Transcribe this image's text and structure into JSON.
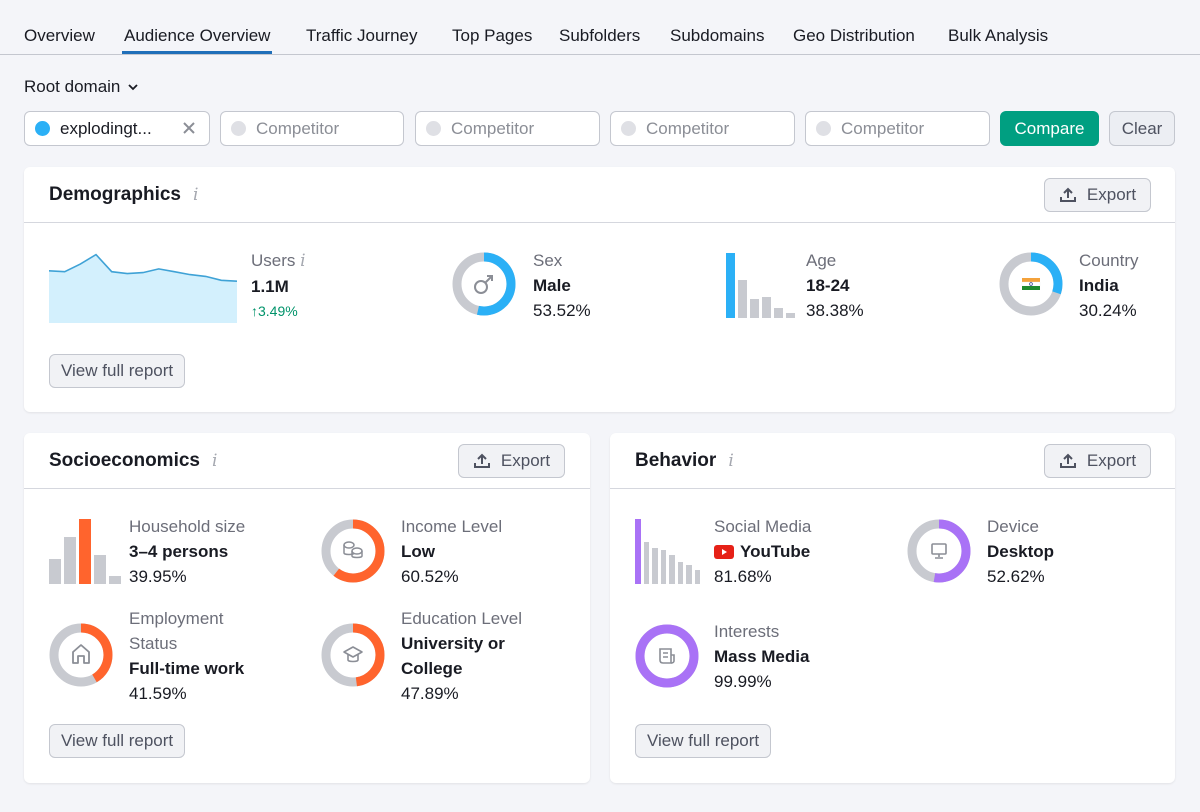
{
  "tabs": [
    {
      "label": "Overview",
      "active": false
    },
    {
      "label": "Audience Overview",
      "active": true
    },
    {
      "label": "Traffic Journey",
      "active": false
    },
    {
      "label": "Top Pages",
      "active": false
    },
    {
      "label": "Subfolders",
      "active": false
    },
    {
      "label": "Subdomains",
      "active": false
    },
    {
      "label": "Geo Distribution",
      "active": false
    },
    {
      "label": "Bulk Analysis",
      "active": false
    }
  ],
  "filters": {
    "scope_label": "Root domain",
    "domain_value": "explodingt...",
    "competitor_placeholder": "Competitor",
    "compare_label": "Compare",
    "clear_label": "Clear"
  },
  "colors": {
    "accent_blue": "#2bb0f6",
    "accent_orange": "#ff642d",
    "accent_purple": "#a972f6",
    "compare_green": "#009f81",
    "growth_green": "#00936a",
    "inactive_gray": "#c8cad0"
  },
  "common": {
    "export_label": "Export",
    "view_report_label": "View full report"
  },
  "demographics": {
    "title": "Demographics",
    "users": {
      "label": "Users",
      "value": "1.1M",
      "growth": "↑3.49%",
      "trend": [
        55,
        54,
        62,
        72,
        54,
        52,
        53,
        57,
        54,
        51,
        49,
        45,
        44
      ]
    },
    "sex": {
      "label": "Sex",
      "value": "Male",
      "pct": "53.52%",
      "share": 53.52
    },
    "age": {
      "label": "Age",
      "value": "18-24",
      "pct": "38.38%",
      "bars": [
        100,
        59,
        30,
        33,
        15,
        8
      ]
    },
    "country": {
      "label": "Country",
      "value": "India",
      "pct": "30.24%",
      "share": 30.24
    }
  },
  "socioeconomics": {
    "title": "Socioeconomics",
    "household": {
      "label": "Household size",
      "value": "3–4 persons",
      "pct": "39.95%",
      "bars": [
        39,
        72,
        100,
        44,
        12
      ],
      "highlight": 2
    },
    "income": {
      "label": "Income Level",
      "value": "Low",
      "pct": "60.52%",
      "share": 60.52
    },
    "employment": {
      "label_line1": "Employment",
      "label_line2": "Status",
      "value": "Full-time work",
      "pct": "41.59%",
      "share": 41.59
    },
    "education": {
      "label": "Education Level",
      "value_line1": "University or",
      "value_line2": "College",
      "pct": "47.89%",
      "share": 47.89
    }
  },
  "behavior": {
    "title": "Behavior",
    "social": {
      "label": "Social Media",
      "value": "YouTube",
      "pct": "81.68%",
      "bars": [
        100,
        64,
        55,
        53,
        44,
        34,
        29,
        22
      ]
    },
    "device": {
      "label": "Device",
      "value": "Desktop",
      "pct": "52.62%",
      "share": 52.62
    },
    "interests": {
      "label": "Interests",
      "value": "Mass Media",
      "pct": "99.99%",
      "share": 99.99
    }
  }
}
